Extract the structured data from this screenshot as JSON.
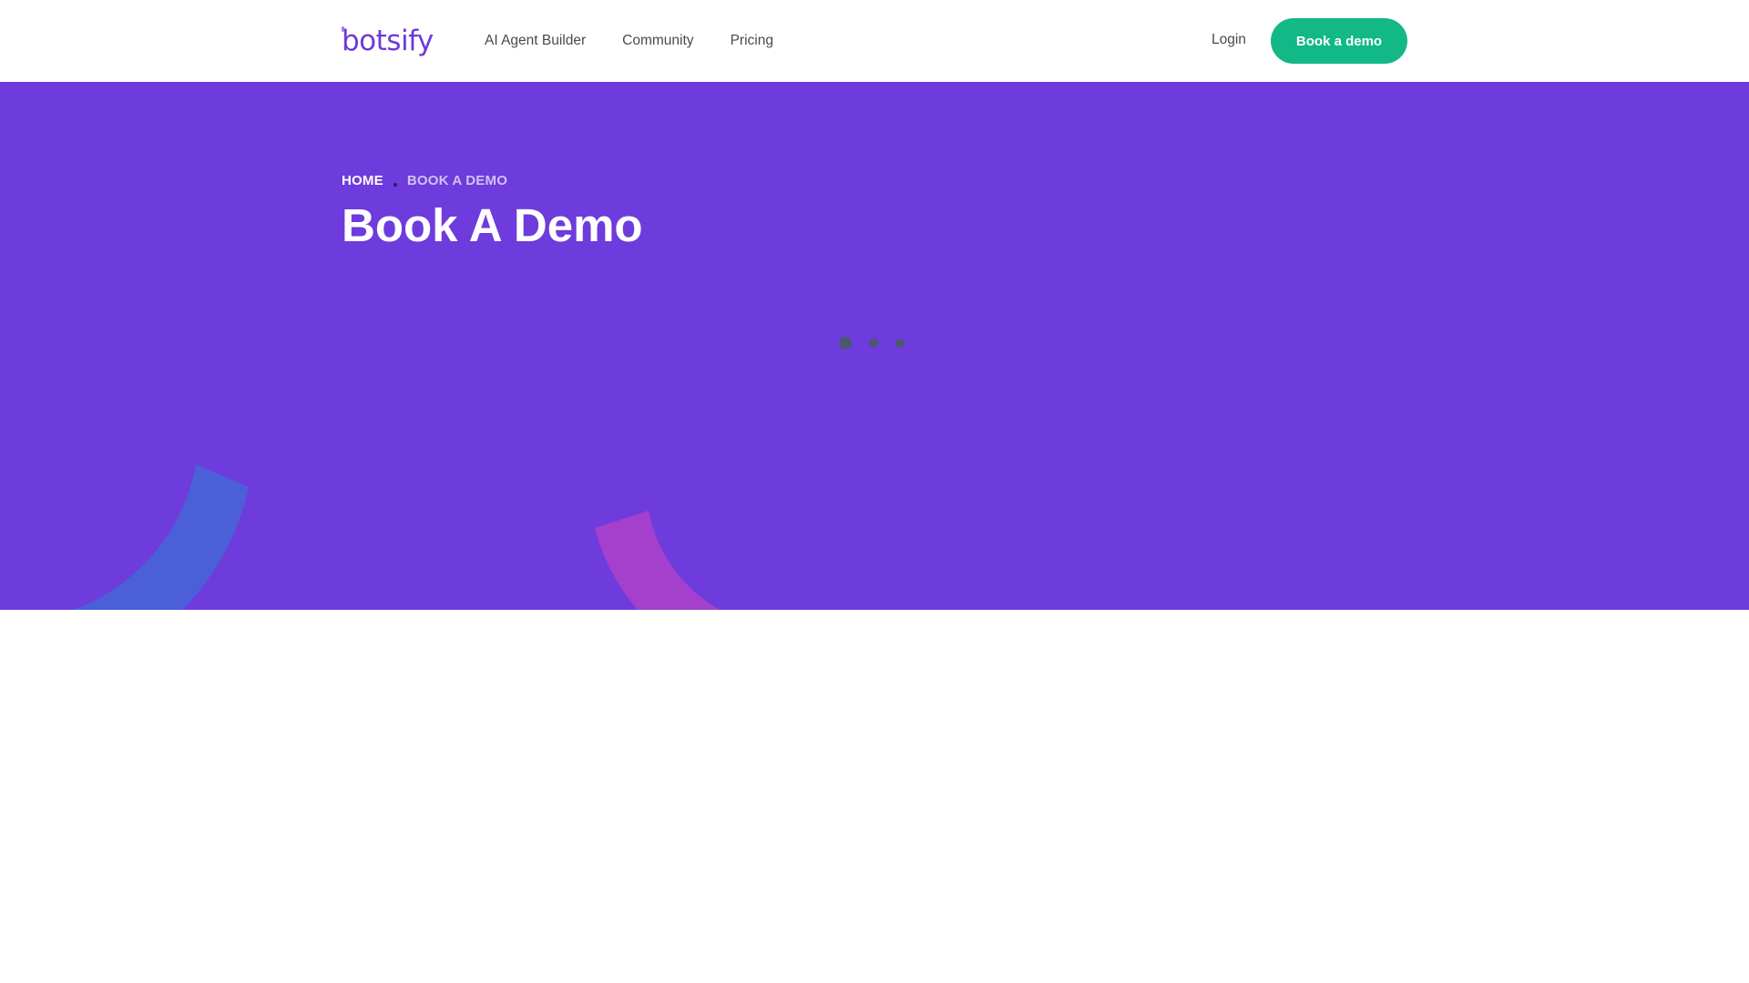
{
  "header": {
    "logo_text": "botsify",
    "nav": [
      {
        "label": "AI Agent Builder"
      },
      {
        "label": "Community"
      },
      {
        "label": "Pricing"
      }
    ],
    "login_label": "Login",
    "demo_button_label": "Book a demo"
  },
  "hero": {
    "breadcrumb": {
      "home": "HOME",
      "current": "BOOK A DEMO"
    },
    "title": "Book A Demo"
  },
  "colors": {
    "brand_purple": "#6e3bdc",
    "logo_purple": "#6d3ad8",
    "cta_green": "#12b886",
    "deco_blue": "#4a5fd8",
    "deco_magenta": "#a440cc",
    "loader_gray": "#4c5870"
  },
  "icons": {
    "loader": "loading-dots-icon"
  }
}
